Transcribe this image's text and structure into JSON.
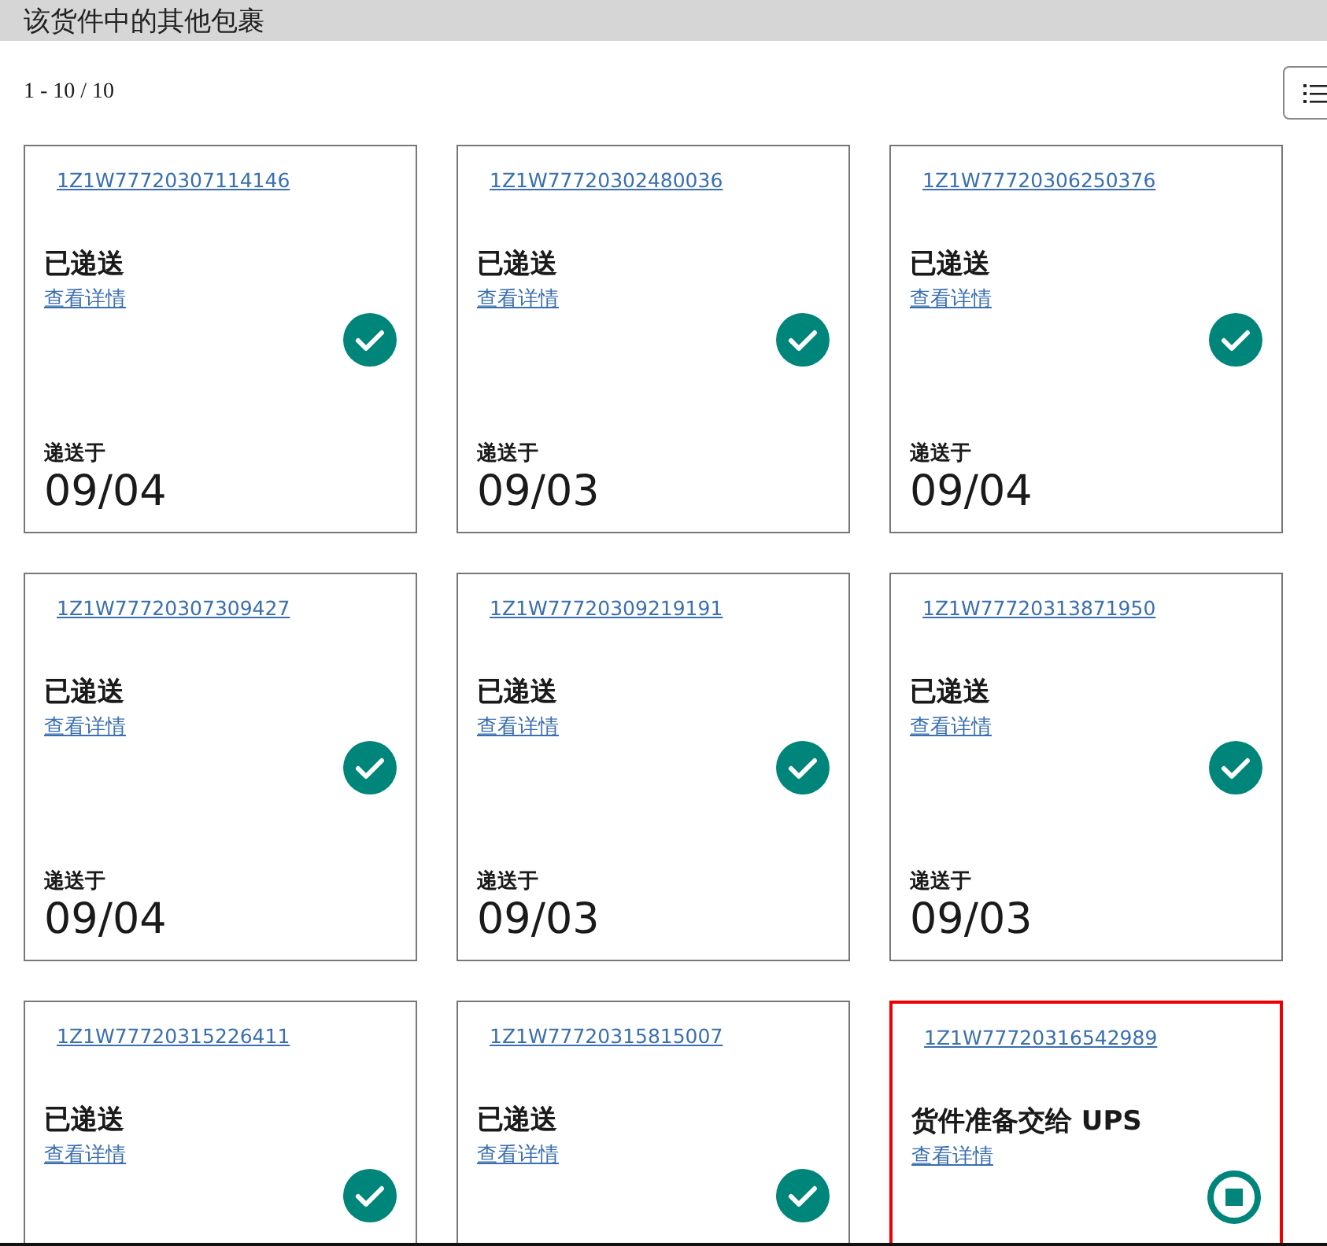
{
  "header": {
    "title": "该货件中的其他包裹"
  },
  "pagination": {
    "range": "1 - 10 / 10"
  },
  "packages": [
    {
      "tracking": "1Z1W77720307114146",
      "status": "已递送",
      "details_link": "查看详情",
      "kind": "delivered",
      "selected": false,
      "delivered_label": "递送于",
      "date": "09/04"
    },
    {
      "tracking": "1Z1W77720302480036",
      "status": "已递送",
      "details_link": "查看详情",
      "kind": "delivered",
      "selected": false,
      "delivered_label": "递送于",
      "date": "09/03"
    },
    {
      "tracking": "1Z1W77720306250376",
      "status": "已递送",
      "details_link": "查看详情",
      "kind": "delivered",
      "selected": false,
      "delivered_label": "递送于",
      "date": "09/04"
    },
    {
      "tracking": "1Z1W77720307309427",
      "status": "已递送",
      "details_link": "查看详情",
      "kind": "delivered",
      "selected": false,
      "delivered_label": "递送于",
      "date": "09/04"
    },
    {
      "tracking": "1Z1W77720309219191",
      "status": "已递送",
      "details_link": "查看详情",
      "kind": "delivered",
      "selected": false,
      "delivered_label": "递送于",
      "date": "09/03"
    },
    {
      "tracking": "1Z1W77720313871950",
      "status": "已递送",
      "details_link": "查看详情",
      "kind": "delivered",
      "selected": false,
      "delivered_label": "递送于",
      "date": "09/03"
    },
    {
      "tracking": "1Z1W77720315226411",
      "status": "已递送",
      "details_link": "查看详情",
      "kind": "delivered",
      "selected": false
    },
    {
      "tracking": "1Z1W77720315815007",
      "status": "已递送",
      "details_link": "查看详情",
      "kind": "delivered",
      "selected": false
    },
    {
      "tracking": "1Z1W77720316542989",
      "status": "货件准备交给 UPS",
      "details_link": "查看详情",
      "kind": "pending",
      "selected": true
    }
  ]
}
